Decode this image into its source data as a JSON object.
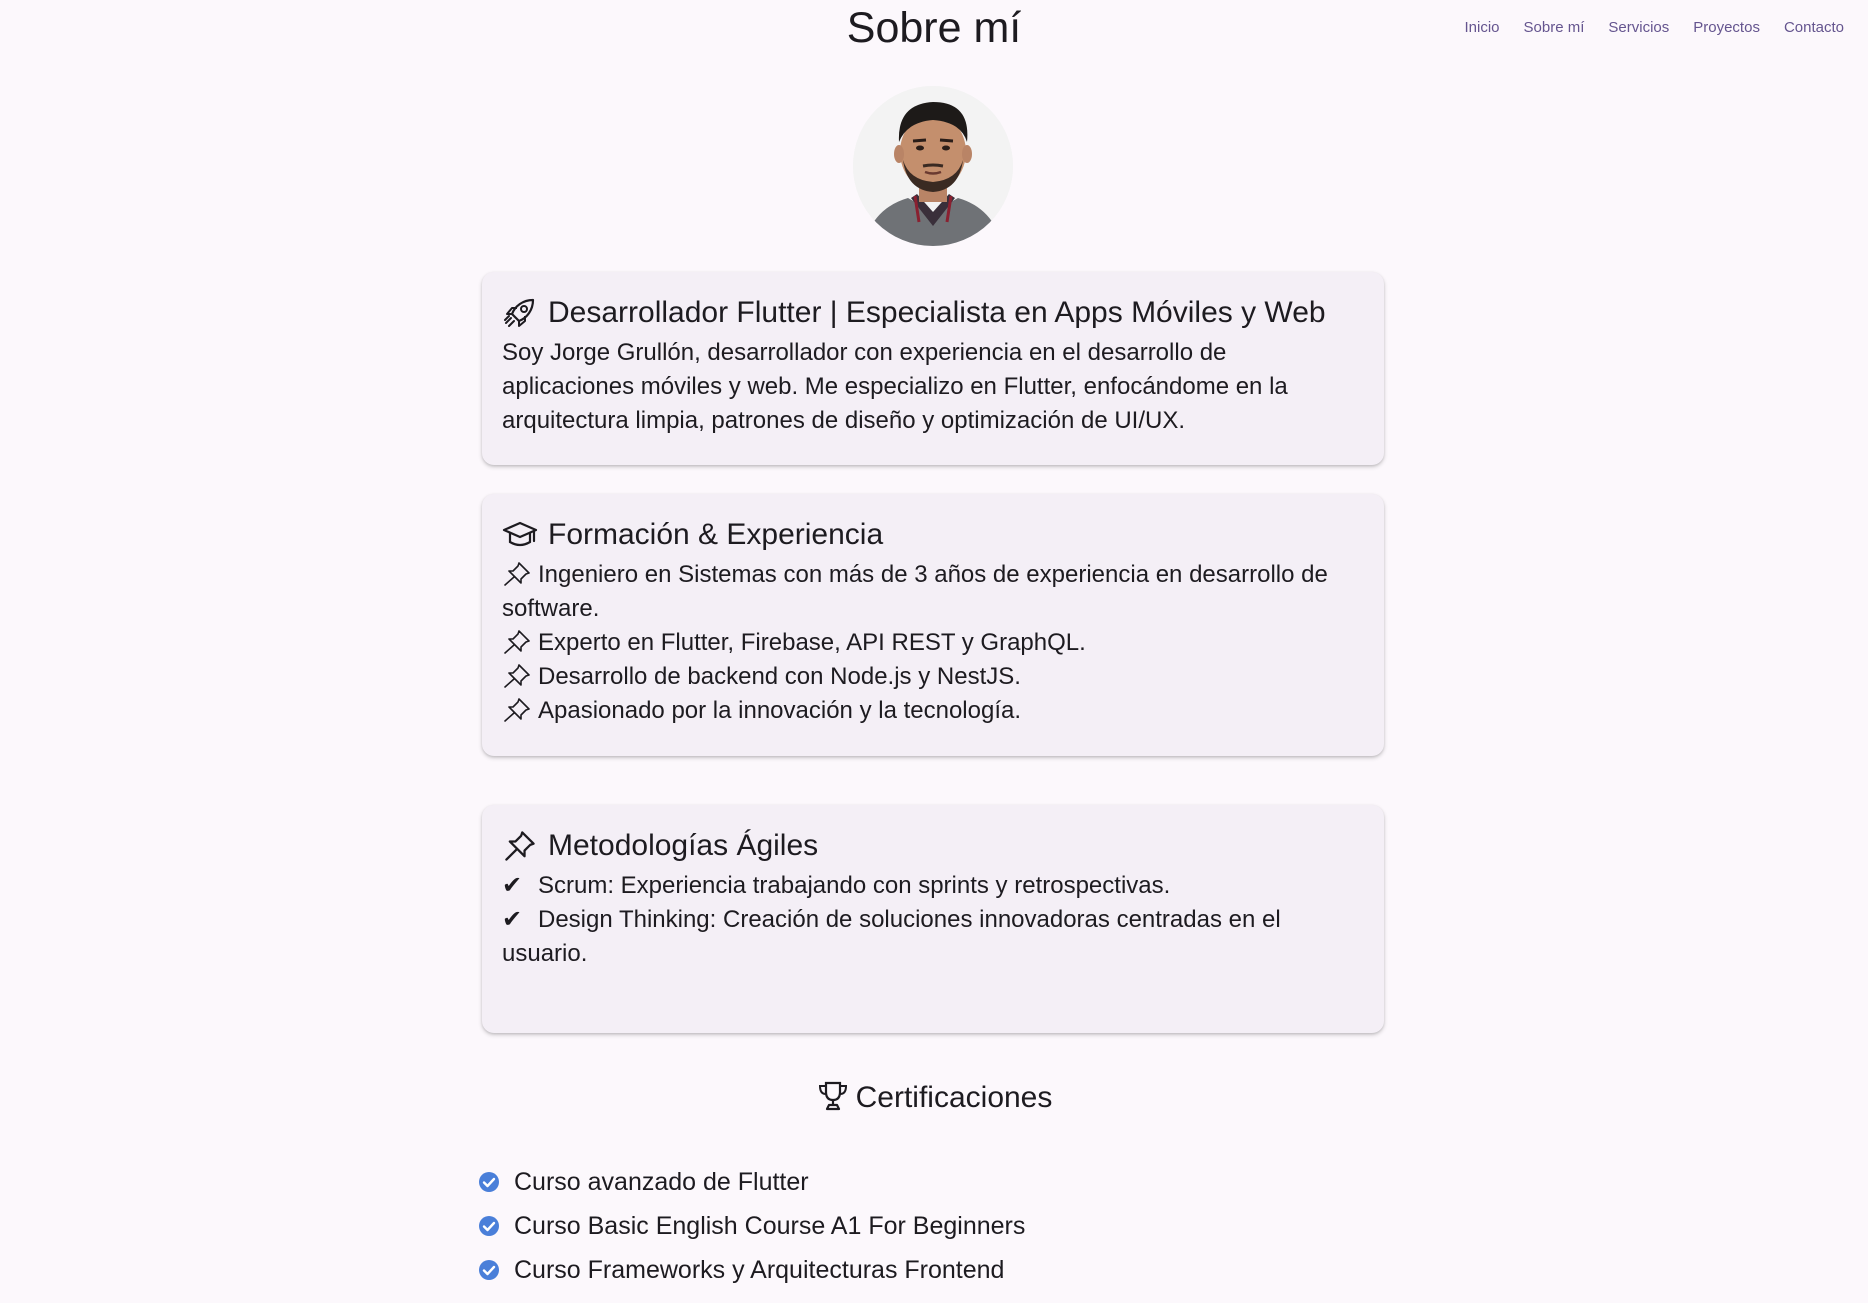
{
  "header": {
    "title": "Sobre mí",
    "nav": [
      "Inicio",
      "Sobre mí",
      "Servicios",
      "Proyectos",
      "Contacto"
    ]
  },
  "profile": {
    "avatar_icon": "profile-photo"
  },
  "cards": {
    "role": {
      "icon": "rocket-icon",
      "heading": "Desarrollador Flutter | Especialista en Apps Móviles y Web",
      "text": "Soy Jorge Grullón, desarrollador con experiencia en el desarrollo de aplicaciones móviles y web. Me especializo en Flutter, enfocándome en la arquitectura limpia, patrones de diseño y optimización de UI/UX."
    },
    "education": {
      "icon": "graduation-cap-icon",
      "heading": "Formación & Experiencia",
      "items": [
        "Ingeniero en Sistemas con más de 3 años de experiencia en desarrollo de software.",
        "Experto en Flutter, Firebase, API REST y GraphQL.",
        "Desarrollo de backend con Node.js y NestJS.",
        "Apasionado por la innovación y la tecnología."
      ]
    },
    "agile": {
      "icon": "pushpin-icon",
      "heading": "Metodologías Ágiles",
      "check_glyph": "✔",
      "items": [
        "Scrum: Experiencia trabajando con sprints y retrospectivas.",
        "Design Thinking: Creación de soluciones innovadoras centradas en el usuario."
      ]
    }
  },
  "certifications": {
    "icon": "trophy-icon",
    "heading": "Certificaciones",
    "items": [
      "Curso avanzado de Flutter",
      "Curso Basic English Course A1 For Beginners",
      "Curso Frameworks y Arquitecturas Frontend"
    ]
  },
  "colors": {
    "background": "#fcf8fc",
    "card": "#f4eff6",
    "nav_text": "#65558f",
    "check_blue": "#4a7fd9"
  }
}
